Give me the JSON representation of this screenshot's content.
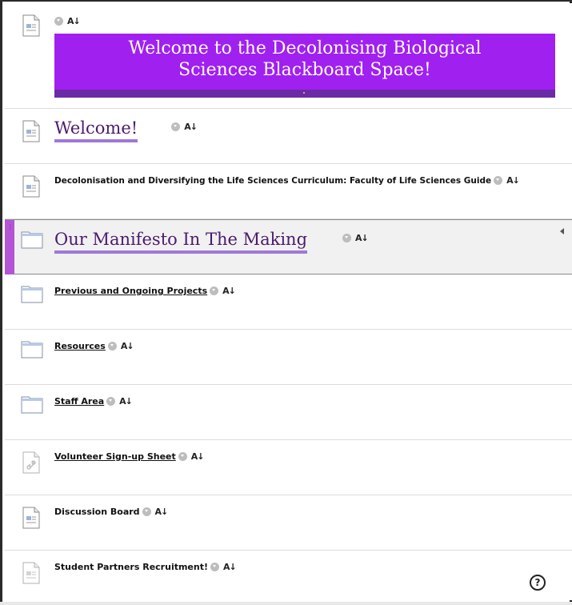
{
  "banner": {
    "line1": "Welcome to the Decolonising Biological",
    "line2": "Sciences Blackboard Space!"
  },
  "items": [
    {
      "title": "Welcome!"
    },
    {
      "title": "Decolonisation and Diversifying the Life Sciences Curriculum: Faculty of Life Sciences Guide"
    },
    {
      "title": "Our Manifesto In The Making"
    },
    {
      "title": "Previous and Ongoing Projects"
    },
    {
      "title": "Resources"
    },
    {
      "title": "Staff Area"
    },
    {
      "title": "Volunteer Sign-up Sheet"
    },
    {
      "title": "Discussion Board"
    },
    {
      "title": "Student Partners Recruitment!"
    }
  ],
  "controls": {
    "accessibility_label": "A↓",
    "help_label": "?"
  },
  "icons": {
    "document": "document-icon",
    "folder": "folder-icon",
    "link": "link-icon",
    "context": "chevron-down-icon",
    "accessibility": "alternative-formats-icon",
    "help": "help-icon"
  },
  "colors": {
    "banner": "#a020f0",
    "banner_strip": "#6b2aa6",
    "heading": "#4b1a6e",
    "heading_underline": "#9f78d8",
    "drag_handle": "#b455d6"
  }
}
